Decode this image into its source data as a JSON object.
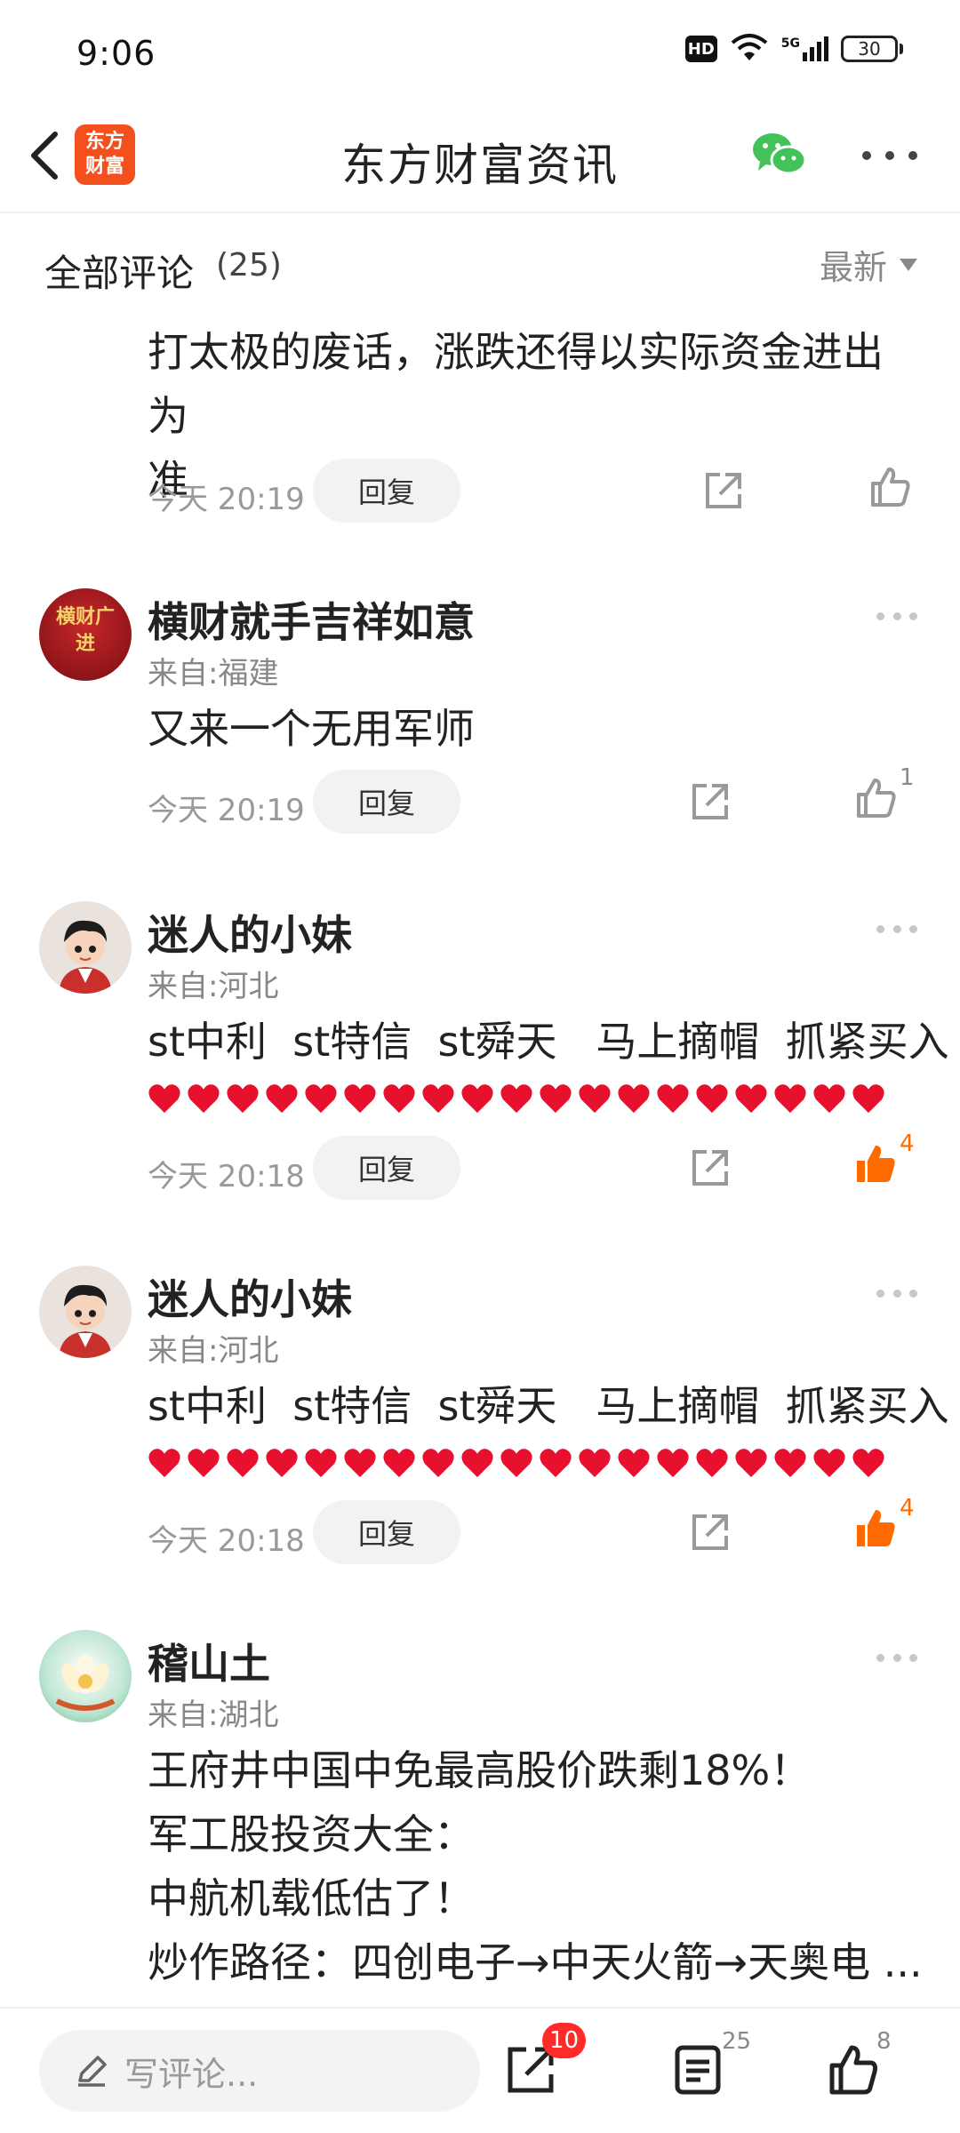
{
  "status_bar": {
    "time": "9:06",
    "battery": "30",
    "hd": "HD",
    "network": "5G"
  },
  "header": {
    "title": "东方财富资讯",
    "logo_line1": "东方",
    "logo_line2": "财富"
  },
  "comments_bar": {
    "title": "全部评论",
    "count": "(25)",
    "sort_label": "最新"
  },
  "comments": [
    {
      "text_lines": [
        "打太极的废话，涨跌还得以实际资金进出为",
        "准"
      ],
      "time": "今天 20:19",
      "reply_label": "回复",
      "likes": "",
      "liked": false
    },
    {
      "username": "横财就手吉祥如意",
      "location": "来自:福建",
      "text_lines": [
        "又来一个无用军师"
      ],
      "time": "今天 20:19",
      "reply_label": "回复",
      "likes": "1",
      "liked": false,
      "avatar_text": "横财广进"
    },
    {
      "username": "迷人的小妹",
      "location": "来自:河北",
      "text_lines": [
        "st中利  st特信  st舜天   马上摘帽  抓紧买入"
      ],
      "hearts": 19,
      "time": "今天 20:18",
      "reply_label": "回复",
      "likes": "4",
      "liked": true
    },
    {
      "username": "迷人的小妹",
      "location": "来自:河北",
      "text_lines": [
        "st中利  st特信  st舜天   马上摘帽  抓紧买入"
      ],
      "hearts": 19,
      "time": "今天 20:18",
      "reply_label": "回复",
      "likes": "4",
      "liked": true
    },
    {
      "username": "稽山土",
      "location": "来自:湖北",
      "text_lines": [
        "王府井中国中免最高股价跌剩18%！",
        "军工股投资大全：",
        "中航机载低估了！",
        "炒作路径：四创电子→中天火箭→天奥电 ..."
      ]
    }
  ],
  "bottom_bar": {
    "input_placeholder": "写评论...",
    "share_badge": "10",
    "comments_count": "25",
    "likes_count": "8"
  },
  "colors": {
    "accent": "#ff6a00",
    "logo": "#f4501e",
    "badge": "#ff2a2a",
    "heart": "#e8112d",
    "wechat": "#43c25a"
  }
}
